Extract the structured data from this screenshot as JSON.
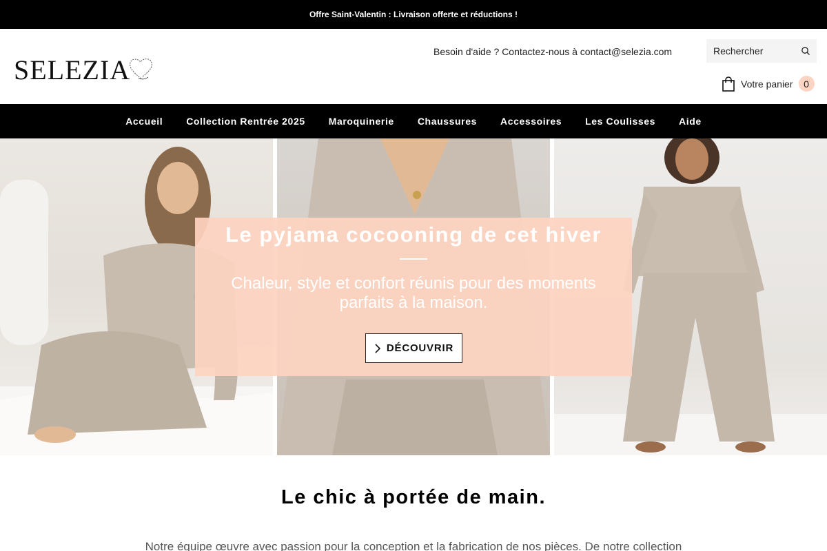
{
  "announcement": {
    "text": "Offre Saint-Valentin : Livraison offerte et réductions !"
  },
  "header": {
    "logo_text": "SELEZIA",
    "help_text": "Besoin d'aide ? Contactez-nous à contact@selezia.com",
    "search": {
      "placeholder": "Rechercher"
    },
    "cart": {
      "label": "Votre panier",
      "count": "0"
    }
  },
  "nav": {
    "items": [
      {
        "label": "Accueil"
      },
      {
        "label": "Collection Rentrée 2025"
      },
      {
        "label": "Maroquinerie"
      },
      {
        "label": "Chaussures"
      },
      {
        "label": "Accessoires"
      },
      {
        "label": "Les Coulisses"
      },
      {
        "label": "Aide"
      }
    ]
  },
  "hero": {
    "title": "Le pyjama cocooning de cet hiver",
    "subtitle": "Chaleur, style et confort réunis pour des moments parfaits à la maison.",
    "cta_label": "DÉCOUVRIR",
    "overlay_color": "#fdd3c1"
  },
  "section": {
    "title": "Le chic à portée de main.",
    "text": "Notre équipe œuvre avec passion pour la conception et la fabrication de nos pièces. De notre collection"
  },
  "colors": {
    "bar": "#000000",
    "accent": "#fcd4c4",
    "text": "#111111"
  }
}
